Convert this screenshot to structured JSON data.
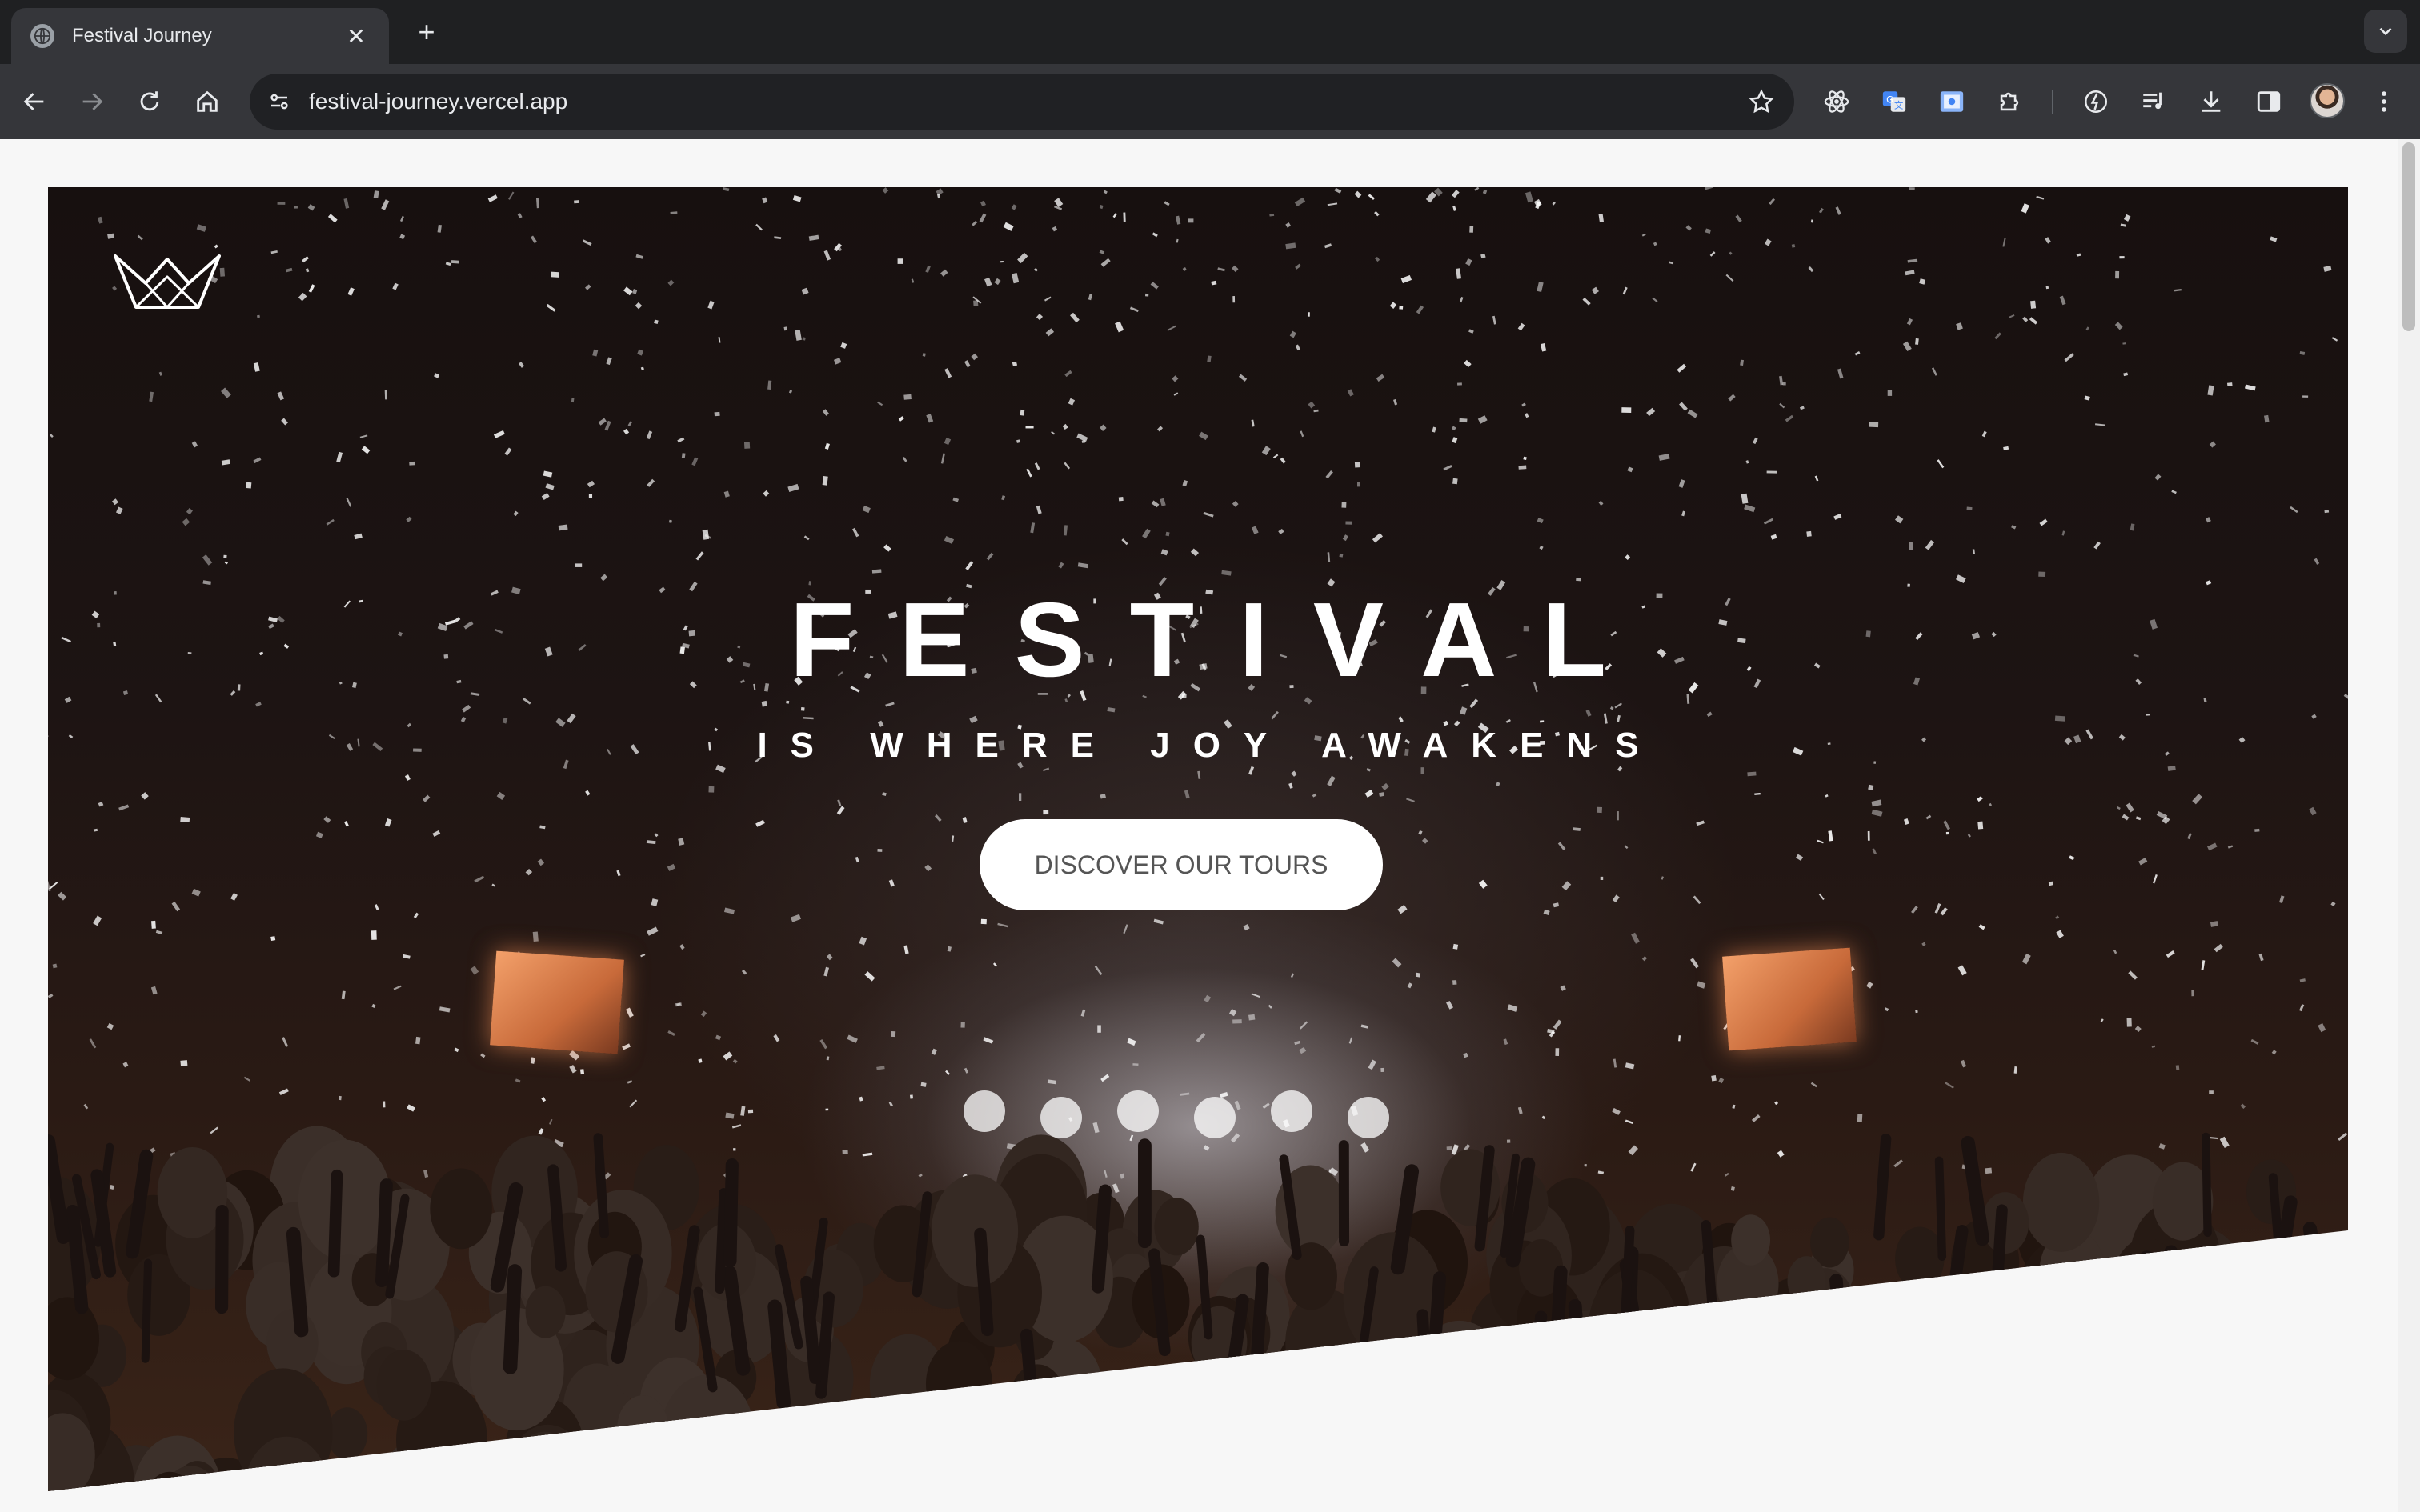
{
  "browser": {
    "tab_title": "Festival Journey",
    "url": "festival-journey.vercel.app"
  },
  "hero": {
    "title": "FESTIVAL",
    "subtitle": "IS WHERE JOY AWAKENS",
    "cta_label": "DISCOVER OUR TOURS"
  },
  "icons": {
    "logo": "crown-logo-icon",
    "back": "back-arrow-icon",
    "forward": "forward-arrow-icon",
    "reload": "reload-icon",
    "home": "home-icon",
    "site_info": "tune-icon",
    "bookmark": "star-icon",
    "extensions": [
      "react-devtools-icon",
      "google-translate-icon",
      "screenshot-extension-icon",
      "puzzle-extensions-icon",
      "performance-icon",
      "media-controls-icon",
      "download-icon",
      "side-panel-icon"
    ],
    "menu": "kebab-menu-icon"
  },
  "colors": {
    "chrome_dark": "#1f2022",
    "toolbar": "#35363a",
    "omnibox": "#202124",
    "page_bg": "#f7f7f7",
    "cta_bg": "#ffffff"
  }
}
